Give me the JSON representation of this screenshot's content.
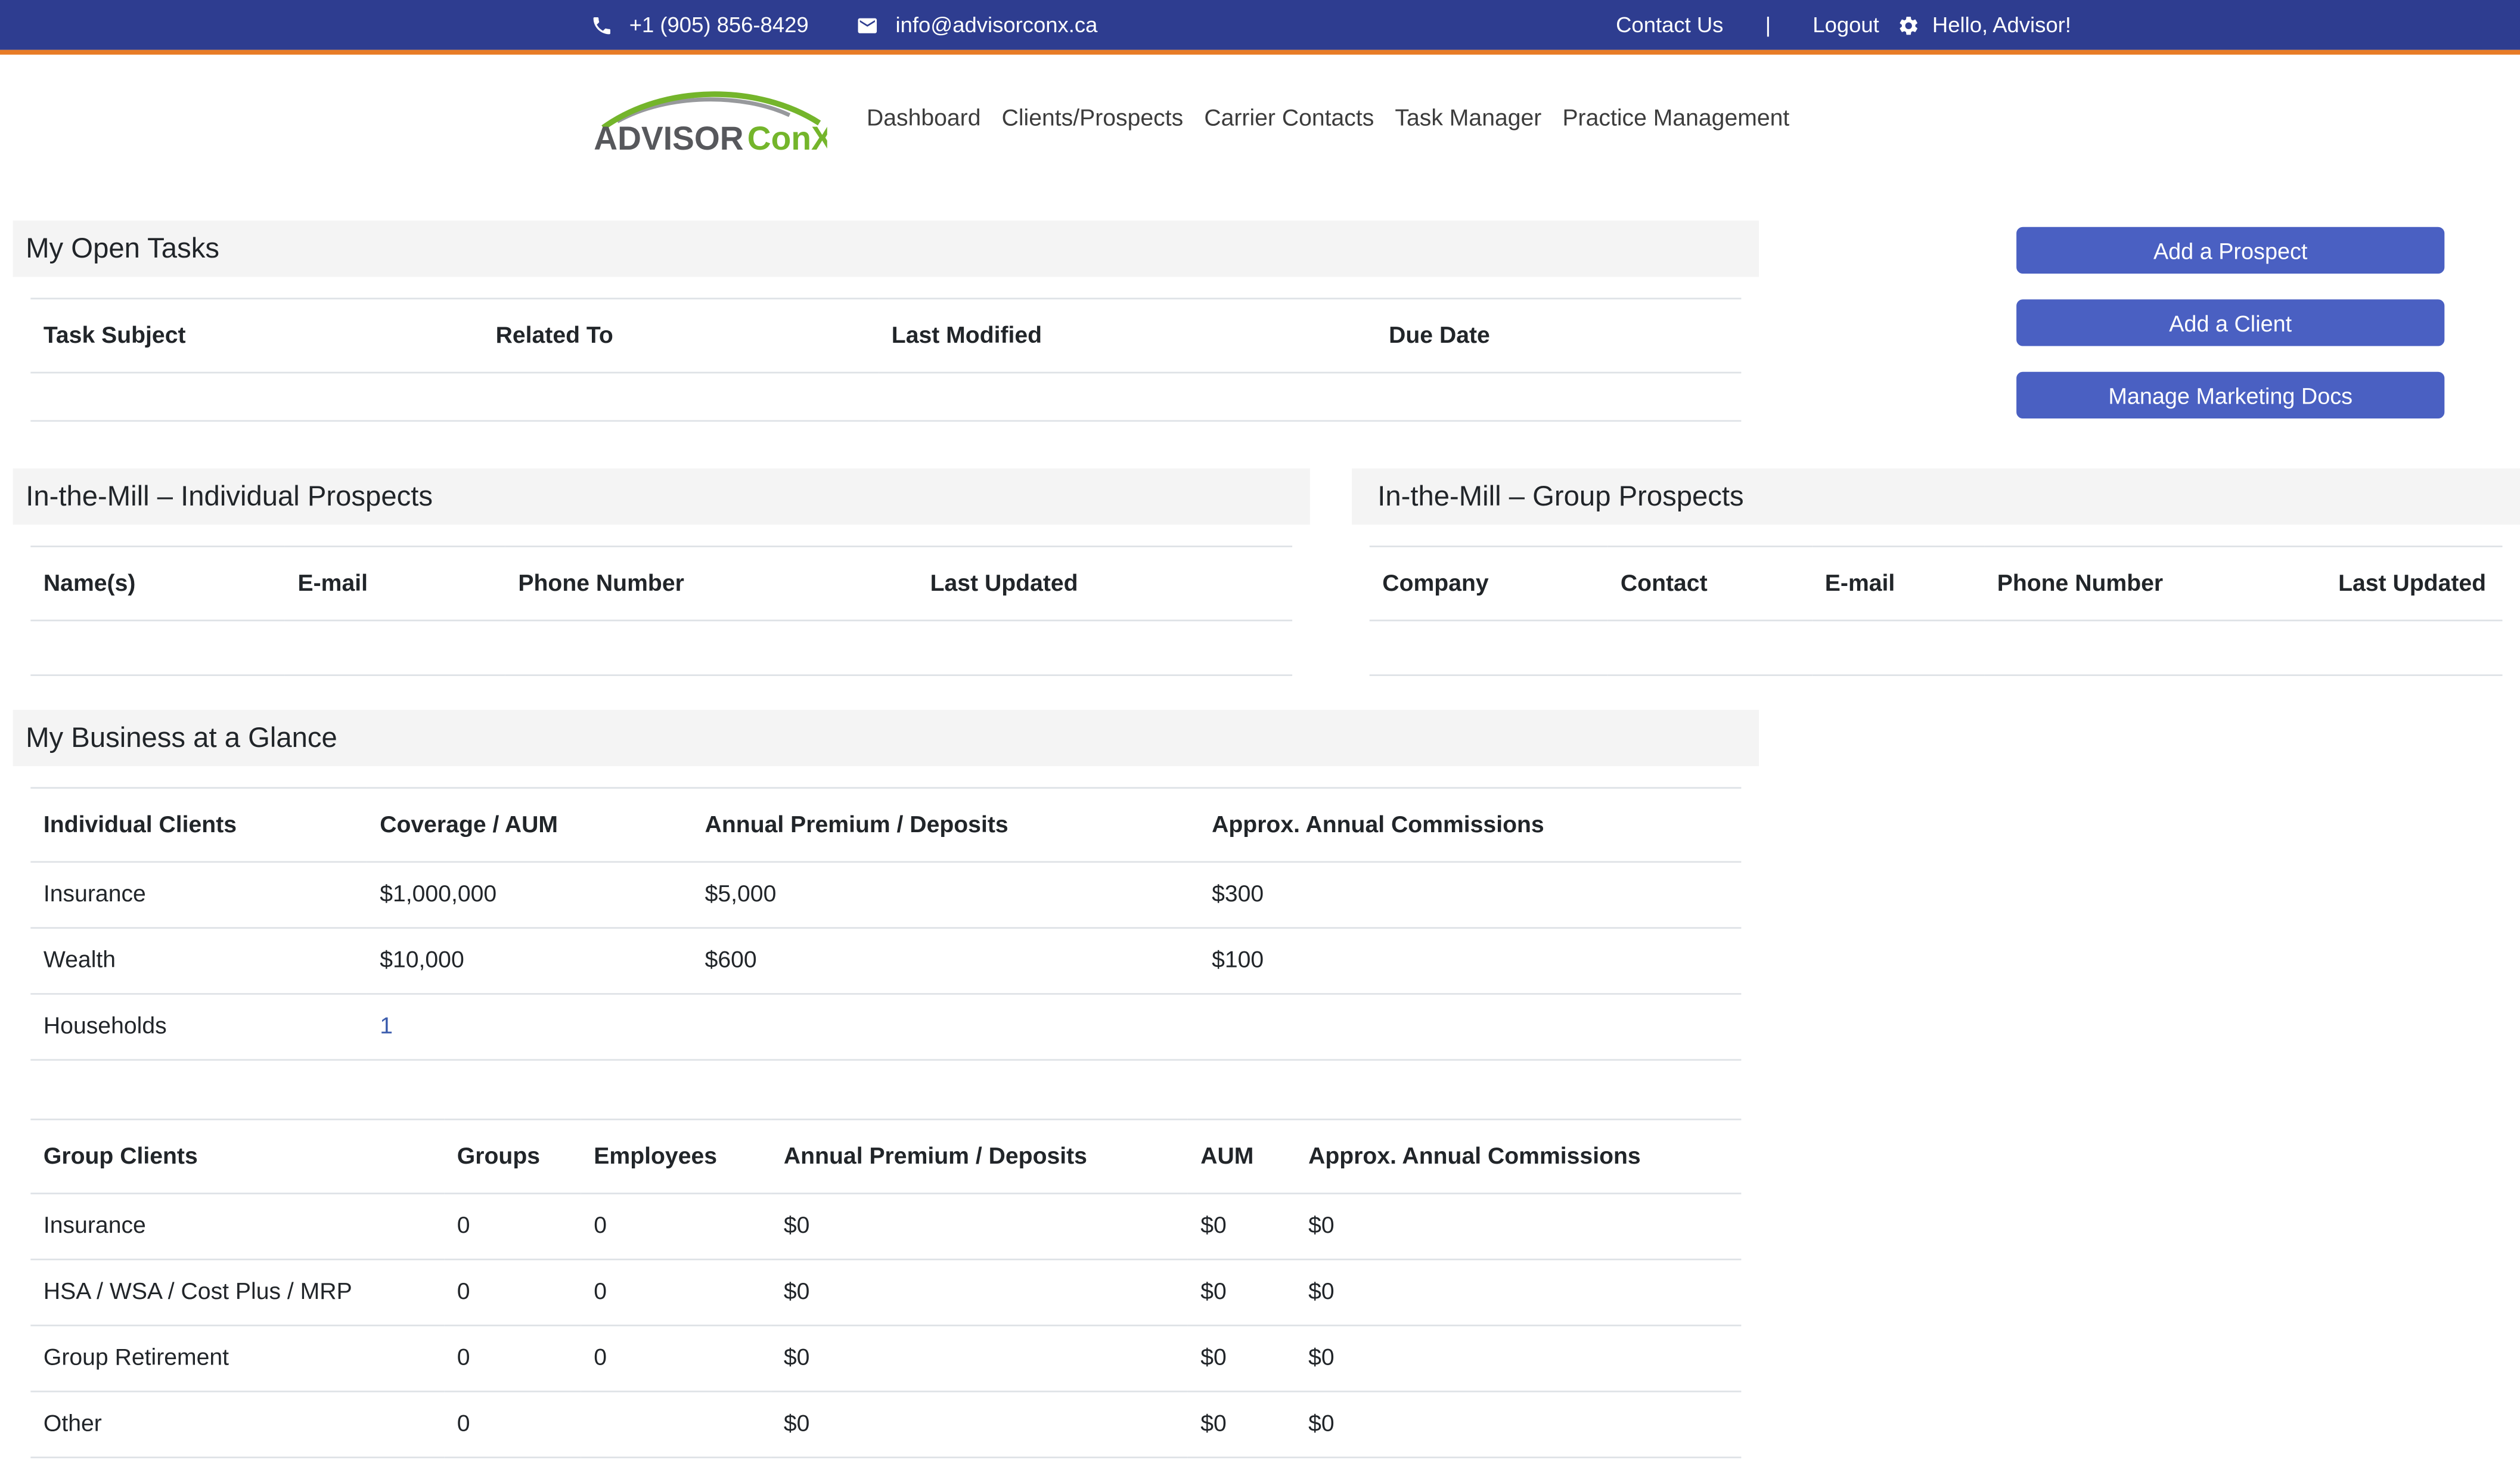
{
  "topbar": {
    "phone": "+1 (905) 856-8429",
    "email": "info@advisorconx.ca",
    "contact_us_label": "Contact Us",
    "divider": "|",
    "logout_label": "Logout",
    "greeting": "Hello, Advisor!"
  },
  "brand": {
    "name_primary": "ADVISOR",
    "name_secondary": "ConX"
  },
  "nav": {
    "items": [
      {
        "label": "Dashboard"
      },
      {
        "label": "Clients/Prospects"
      },
      {
        "label": "Carrier Contacts"
      },
      {
        "label": "Task Manager"
      },
      {
        "label": "Practice Management"
      }
    ]
  },
  "quick_actions": {
    "add_prospect_label": "Add a Prospect",
    "add_client_label": "Add a Client",
    "manage_marketing_docs_label": "Manage Marketing Docs"
  },
  "open_tasks": {
    "title": "My Open Tasks",
    "columns": [
      "Task Subject",
      "Related To",
      "Last Modified",
      "Due Date"
    ],
    "rows": []
  },
  "individual_prospects": {
    "title": "In-the-Mill – Individual Prospects",
    "columns": [
      "Name(s)",
      "E-mail",
      "Phone Number",
      "Last Updated"
    ],
    "rows": []
  },
  "group_prospects": {
    "title": "In-the-Mill – Group Prospects",
    "columns": [
      "Company",
      "Contact",
      "E-mail",
      "Phone Number",
      "Last Updated"
    ],
    "rows": []
  },
  "business_at_a_glance": {
    "title": "My Business at a Glance",
    "individual_table": {
      "columns": [
        "Individual Clients",
        "Coverage / AUM",
        "Annual Premium / Deposits",
        "Approx. Annual Commissions"
      ],
      "rows": [
        [
          "Insurance",
          "$1,000,000",
          "$5,000",
          "$300"
        ],
        [
          "Wealth",
          "$10,000",
          "$600",
          "$100"
        ],
        [
          "Households",
          "1",
          "",
          ""
        ]
      ]
    },
    "group_table": {
      "columns": [
        "Group Clients",
        "Groups",
        "Employees",
        "Annual Premium / Deposits",
        "AUM",
        "Approx. Annual Commissions"
      ],
      "rows": [
        [
          "Insurance",
          "0",
          "0",
          "$0",
          "$0",
          "$0"
        ],
        [
          "HSA / WSA / Cost Plus / MRP",
          "0",
          "0",
          "$0",
          "$0",
          "$0"
        ],
        [
          "Group Retirement",
          "0",
          "0",
          "$0",
          "$0",
          "$0"
        ],
        [
          "Other",
          "0",
          "",
          "$0",
          "$0",
          "$0"
        ]
      ]
    }
  },
  "colors": {
    "topbar_bg": "#2e3d90",
    "accent_orange": "#e87c26",
    "button_bg": "#4a60c2",
    "brand_green": "#74b52b",
    "brand_gray": "#57585c",
    "link_blue": "#3b5cad",
    "panel_header_bg": "#f4f4f4",
    "table_border": "#dee2e6"
  }
}
